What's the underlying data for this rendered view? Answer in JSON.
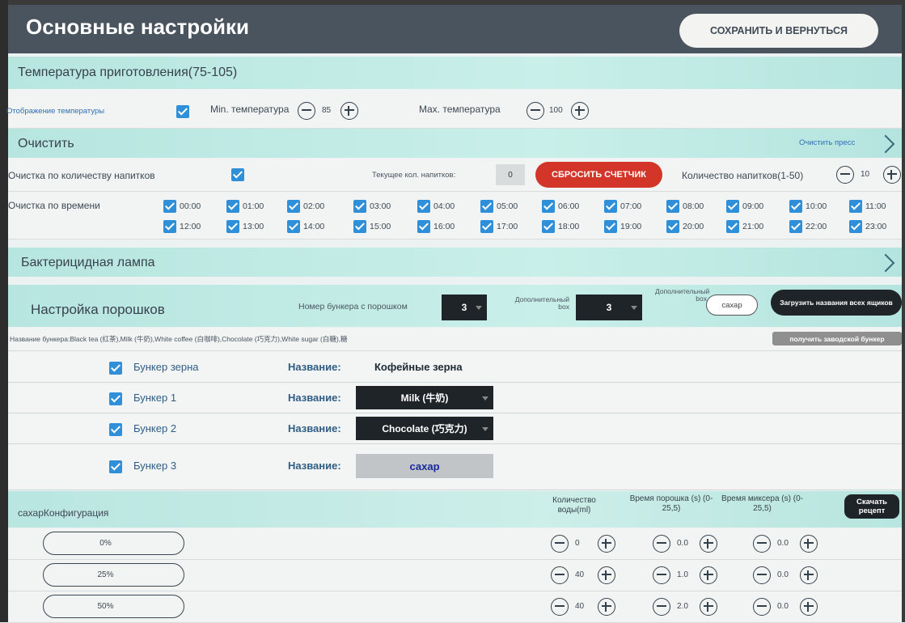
{
  "header": {
    "title": "Основные настройки",
    "save_button": "СОХРАНИТЬ И ВЕРНУТЬСЯ"
  },
  "temperature": {
    "title": "Температура приготовления(75-105)",
    "display_label": "Отображение температуры",
    "min_label": "Min. температура",
    "min_value": "85",
    "max_label": "Max. температура",
    "max_value": "100"
  },
  "cleaning": {
    "title": "Очистить",
    "clean_press": "Очистить пресс",
    "by_count_label": "Очистка по количеству напитков",
    "current_count_label": "Текущее кол. напитков:",
    "current_count_value": "0",
    "reset_button": "СБРОСИТЬ СЧЕТЧИК",
    "drinks_count_label": "Количество напитков(1-50)",
    "drinks_count_value": "10",
    "by_time_label": "Очистка по времени",
    "times": [
      "00:00",
      "01:00",
      "02:00",
      "03:00",
      "04:00",
      "05:00",
      "06:00",
      "07:00",
      "08:00",
      "09:00",
      "10:00",
      "11:00",
      "12:00",
      "13:00",
      "14:00",
      "15:00",
      "16:00",
      "17:00",
      "18:00",
      "19:00",
      "20:00",
      "21:00",
      "22:00",
      "23:00"
    ]
  },
  "uv_lamp": {
    "title": "Бактерицидная лампа"
  },
  "powders": {
    "title": "Настройка порошков",
    "hopper_number_label": "Номер бункера с порошком",
    "hopper_number_value": "3",
    "extra_box_label": "Дополнительный box",
    "extra_box_value": "3",
    "extra_box_name_label": "Дополнительный box",
    "extra_box_name_value": "сахар",
    "load_names_button": "Загрузить названия всех ящиков",
    "hopper_names_text": "Название бункера:Black tea (红茶),Milk (牛奶),White coffee (白咖啡),Chocolate (巧克力),White sugar (白糖),糖",
    "factory_button": "получить заводской бункер",
    "name_label": "Название:",
    "bunkers": [
      {
        "label": "Бункер зерна",
        "name": "Кофейные зерна"
      },
      {
        "label": "Бункер 1",
        "name": "Milk (牛奶)"
      },
      {
        "label": "Бункер 2",
        "name": "Chocolate (巧克力)"
      },
      {
        "label": "Бункер 3",
        "name": "сахар"
      }
    ]
  },
  "sugar_config": {
    "title": "сахарКонфигурация",
    "col_water": "Количество воды(ml)",
    "col_powder": "Время порошка (s) (0-25,5)",
    "col_mixer": "Время миксера (s) (0-25,5)",
    "download_button": "Скачать рецепт",
    "rows": [
      {
        "level": "0%",
        "water": "0",
        "powder": "0.0",
        "mixer": "0.0"
      },
      {
        "level": "25%",
        "water": "40",
        "powder": "1.0",
        "mixer": "0.0"
      },
      {
        "level": "50%",
        "water": "40",
        "powder": "2.0",
        "mixer": "0.0"
      }
    ]
  }
}
